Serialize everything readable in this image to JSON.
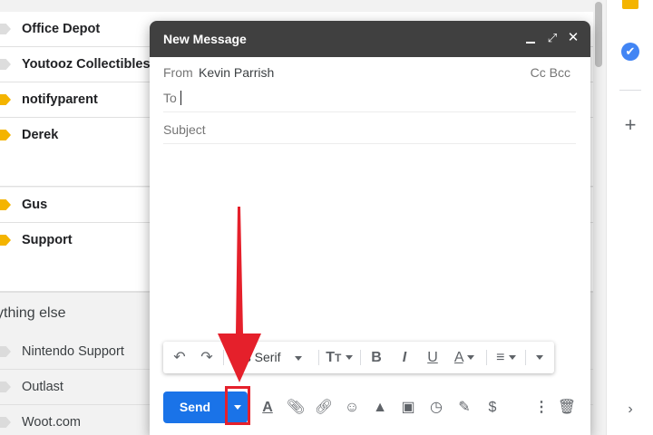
{
  "inbox": {
    "rows": [
      {
        "sender": "Office Depot"
      },
      {
        "sender": "Youtooz Collectibles"
      },
      {
        "sender": "notifyparent"
      },
      {
        "sender": "Derek"
      },
      {
        "sender": "Gus"
      },
      {
        "sender": "Support"
      }
    ],
    "section_label": "ything else",
    "other_rows": [
      {
        "sender": "Nintendo Support"
      },
      {
        "sender": "Outlast"
      },
      {
        "sender": "Woot.com"
      }
    ]
  },
  "compose": {
    "title": "New Message",
    "from_label": "From",
    "from_name": "Kevin Parrish",
    "cc_bcc": "Cc Bcc",
    "to_label": "To",
    "subject_placeholder": "Subject",
    "toolbar": {
      "font_name": "ns Serif",
      "bold": "B",
      "italic": "I",
      "underline": "U",
      "text_color": "A"
    },
    "send_label": "Send"
  },
  "colors": {
    "send_blue": "#1a73e8",
    "header_dark": "#404040",
    "annotation_red": "#e5202b",
    "label_yellow": "#f4b400"
  },
  "icons": [
    "minimize-icon",
    "fullscreen-icon",
    "close-icon",
    "undo-icon",
    "redo-icon",
    "text-size-icon",
    "align-icon",
    "more-formatting-icon",
    "formatting-options-icon",
    "attach-icon",
    "link-icon",
    "emoji-icon",
    "drive-icon",
    "photo-icon",
    "confidential-icon",
    "signature-icon",
    "dollar-icon",
    "more-options-icon",
    "trash-icon",
    "keep-icon",
    "tasks-icon",
    "add-icon",
    "expand-icon"
  ]
}
